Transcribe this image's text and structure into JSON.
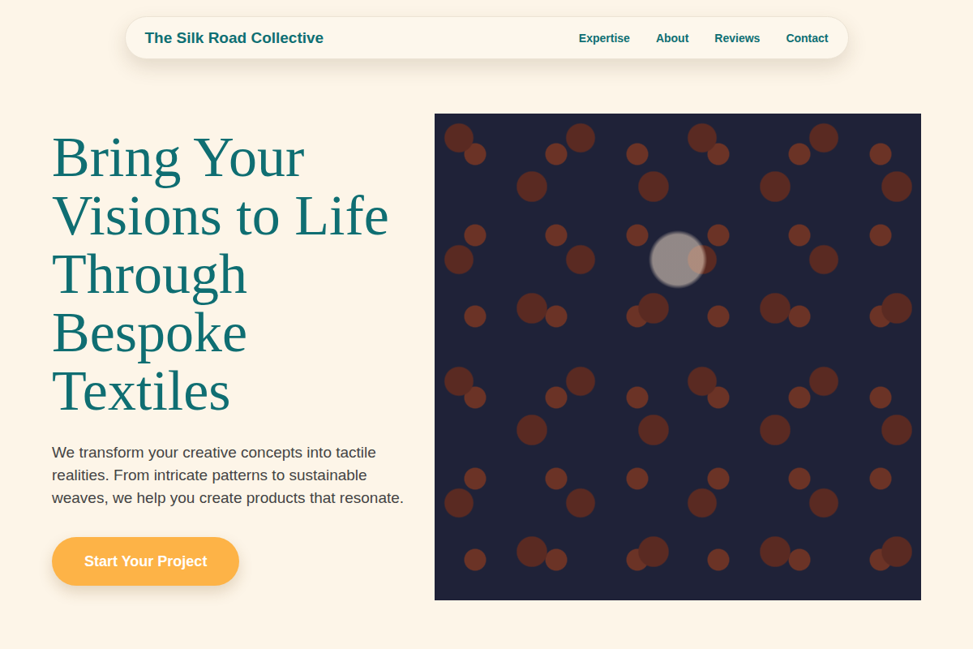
{
  "nav": {
    "brand": "The Silk Road Collective",
    "links": [
      "Expertise",
      "About",
      "Reviews",
      "Contact"
    ]
  },
  "hero": {
    "title": "Bring Your Visions to Life Through Bespoke Textiles",
    "text": "We transform your creative concepts into tactile realities. From intricate patterns to sustainable weaves, we help you create products that resonate.",
    "button": "Start Your Project"
  }
}
